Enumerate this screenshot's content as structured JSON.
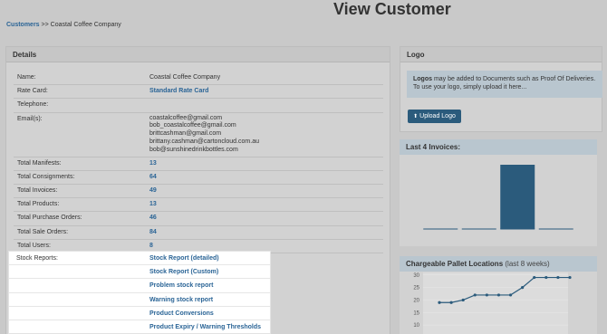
{
  "page": {
    "title": "View Customer",
    "breadcrumb": {
      "link": "Customers",
      "separator": ">>",
      "current": "Coastal Coffee Company"
    }
  },
  "details": {
    "heading": "Details",
    "name_label": "Name:",
    "name_value": "Coastal Coffee Company",
    "rate_card_label": "Rate Card:",
    "rate_card_value": "Standard Rate Card",
    "telephone_label": "Telephone:",
    "telephone_value": "",
    "emails_label": "Email(s):",
    "emails": [
      "coastalcoffee@gmail.com",
      "bob_coastalcoffee@gmail.com",
      "brittcashman@gmail.com",
      "brittany.cashman@cartoncloud.com.au",
      "bob@sunshinedrinkbottles.com"
    ],
    "totals": [
      {
        "label": "Total Manifests:",
        "value": "13"
      },
      {
        "label": "Total Consignments:",
        "value": "64"
      },
      {
        "label": "Total Invoices:",
        "value": "49"
      },
      {
        "label": "Total Products:",
        "value": "13"
      },
      {
        "label": "Total Purchase Orders:",
        "value": "46"
      },
      {
        "label": "Total Sale Orders:",
        "value": "84"
      },
      {
        "label": "Total Users:",
        "value": "8"
      }
    ],
    "stock_reports_label": "Stock Reports:",
    "stock_reports": [
      "Stock Report (detailed)",
      "Stock Report (Custom)",
      "Problem stock report",
      "Warning stock report",
      "Product Conversions",
      "Product Expiry / Warning Thresholds"
    ]
  },
  "logo": {
    "heading": "Logo",
    "info_bold": "Logos",
    "info_text": " may be added to Documents such as Proof Of Deliveries.",
    "info_line2": "To use your logo, simply upload it here...",
    "upload_label": "Upload Logo",
    "upload_icon": "upload-icon"
  },
  "invoices": {
    "heading": "Last 4 Invoices:"
  },
  "pallets": {
    "heading": "Chargeable Pallet Locations",
    "subheading": "(last 8 weeks)"
  },
  "colors": {
    "accent": "#2a6496",
    "bar": "#2b5b7c",
    "button": "#2b5b7c"
  },
  "chart_data": [
    {
      "type": "bar",
      "title": "Last 4 Invoices:",
      "categories": [
        "",
        "",
        "",
        ""
      ],
      "values": [
        0,
        0,
        100,
        0
      ],
      "ylim": [
        0,
        100
      ]
    },
    {
      "type": "line",
      "title": "Chargeable Pallet Locations (last 8 weeks)",
      "x": [
        1,
        2,
        3,
        4,
        5,
        6,
        7,
        8,
        9,
        10,
        11,
        12
      ],
      "values": [
        19,
        19,
        20,
        22,
        22,
        22,
        22,
        25,
        29,
        29,
        29,
        29
      ],
      "yticks": [
        "30",
        "25",
        "20",
        "15",
        "10"
      ],
      "ylim": [
        5,
        31
      ]
    }
  ]
}
